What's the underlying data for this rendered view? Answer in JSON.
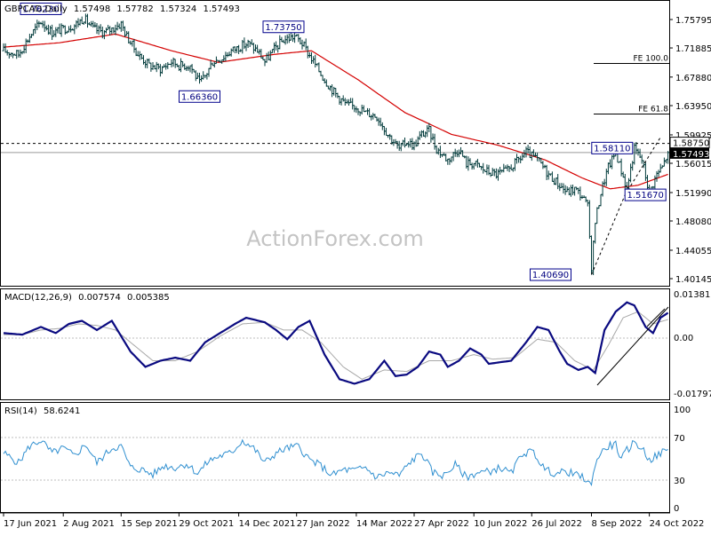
{
  "header": {
    "symbol": "GBPCAD,Daily",
    "ohlc": [
      "1.57498",
      "1.57782",
      "1.57324",
      "1.57493"
    ]
  },
  "watermark": "ActionForex.com",
  "colors": {
    "bar": "#003a3a",
    "ma": "#d40000",
    "macd": "#0a0a80",
    "signal": "#a8a8a8",
    "rsi": "#2f8fd0",
    "label_border": "#00008b",
    "label_text": "#000080",
    "grid": "#d9d9d9",
    "axis": "#000000"
  },
  "x_axis": {
    "labels": [
      "17 Jun 2021",
      "2 Aug 2021",
      "15 Sep 2021",
      "29 Oct 2021",
      "14 Dec 2021",
      "27 Jan 2022",
      "14 Mar 2022",
      "27 Apr 2022",
      "10 Jun 2022",
      "26 Jul 2022",
      "8 Sep 2022",
      "24 Oct 2022"
    ],
    "label_bar_index": [
      0,
      32,
      63,
      94,
      126,
      157,
      189,
      220,
      252,
      283,
      315,
      346
    ]
  },
  "price_axis": {
    "ticks": [
      "1.75795",
      "1.71885",
      "1.67880",
      "1.63950",
      "1.59925",
      "1.56015",
      "1.51990",
      "1.48080",
      "1.44055",
      "1.40145"
    ],
    "current_price": "1.57493",
    "level_price": "1.58750"
  },
  "macd_axis": {
    "title": "MACD(12,26,9)",
    "readout": [
      "0.007574",
      "0.005385"
    ],
    "ticks": [
      "0.013816",
      "0.00",
      "-0.017973"
    ]
  },
  "rsi_axis": {
    "title": "RSI(14)",
    "readout": "58.6241",
    "ticks": [
      "100",
      "70",
      "30",
      "0"
    ]
  },
  "annotations": {
    "highs_lows": [
      {
        "label": "1.76230",
        "price": 1.7623,
        "bar": 20,
        "side": "above"
      },
      {
        "label": "1.66360",
        "price": 1.6636,
        "bar": 105,
        "side": "below"
      },
      {
        "label": "1.73750",
        "price": 1.7375,
        "bar": 150,
        "side": "above"
      },
      {
        "label": "1.58110",
        "price": 1.5811,
        "bar": 338,
        "side": "left"
      },
      {
        "label": "1.51670",
        "price": 1.5167,
        "bar": 332,
        "side": "right"
      },
      {
        "label": "1.40690",
        "price": 1.4069,
        "bar": 305,
        "side": "left"
      }
    ],
    "fibo": [
      {
        "label": "FE 100.0",
        "price": 1.6975
      },
      {
        "label": "FE 61.8",
        "price": 1.628
      }
    ]
  },
  "chart_data": [
    {
      "type": "candlestick",
      "title": "GBPCAD,Daily",
      "timeframe": "Daily",
      "ylim": [
        1.40145,
        1.77
      ],
      "x_range": [
        "17 Jun 2021",
        "8 Nov 2022"
      ],
      "series": [
        {
          "name": "price",
          "key_points": [
            [
              0,
              1.715
            ],
            [
              8,
              1.71
            ],
            [
              14,
              1.735
            ],
            [
              20,
              1.755
            ],
            [
              26,
              1.74
            ],
            [
              32,
              1.745
            ],
            [
              38,
              1.75
            ],
            [
              43,
              1.76
            ],
            [
              48,
              1.745
            ],
            [
              54,
              1.74
            ],
            [
              58,
              1.745
            ],
            [
              63,
              1.752
            ],
            [
              66,
              1.735
            ],
            [
              72,
              1.71
            ],
            [
              78,
              1.695
            ],
            [
              84,
              1.69
            ],
            [
              90,
              1.7
            ],
            [
              94,
              1.695
            ],
            [
              100,
              1.695
            ],
            [
              105,
              1.67
            ],
            [
              108,
              1.68
            ],
            [
              112,
              1.7
            ],
            [
              117,
              1.705
            ],
            [
              122,
              1.715
            ],
            [
              126,
              1.72
            ],
            [
              131,
              1.725
            ],
            [
              136,
              1.715
            ],
            [
              140,
              1.7
            ],
            [
              146,
              1.72
            ],
            [
              150,
              1.73
            ],
            [
              156,
              1.735
            ],
            [
              160,
              1.725
            ],
            [
              166,
              1.7
            ],
            [
              172,
              1.675
            ],
            [
              178,
              1.655
            ],
            [
              184,
              1.64
            ],
            [
              189,
              1.638
            ],
            [
              194,
              1.63
            ],
            [
              200,
              1.625
            ],
            [
              206,
              1.6
            ],
            [
              212,
              1.58
            ],
            [
              216,
              1.59
            ],
            [
              220,
              1.585
            ],
            [
              224,
              1.6
            ],
            [
              228,
              1.605
            ],
            [
              232,
              1.58
            ],
            [
              238,
              1.565
            ],
            [
              244,
              1.58
            ],
            [
              248,
              1.56
            ],
            [
              252,
              1.56
            ],
            [
              258,
              1.55
            ],
            [
              264,
              1.545
            ],
            [
              270,
              1.55
            ],
            [
              276,
              1.565
            ],
            [
              280,
              1.575
            ],
            [
              286,
              1.565
            ],
            [
              292,
              1.545
            ],
            [
              298,
              1.53
            ],
            [
              302,
              1.52
            ],
            [
              306,
              1.525
            ],
            [
              310,
              1.515
            ],
            [
              313,
              1.5
            ],
            [
              315,
              1.418
            ],
            [
              317,
              1.48
            ],
            [
              320,
              1.52
            ],
            [
              324,
              1.555
            ],
            [
              328,
              1.575
            ],
            [
              331,
              1.55
            ],
            [
              334,
              1.525
            ],
            [
              338,
              1.58
            ],
            [
              342,
              1.565
            ],
            [
              346,
              1.52
            ],
            [
              350,
              1.545
            ],
            [
              353,
              1.555
            ],
            [
              356,
              1.5749
            ]
          ]
        },
        {
          "name": "MA",
          "key_points": [
            [
              0,
              1.72
            ],
            [
              30,
              1.726
            ],
            [
              60,
              1.738
            ],
            [
              90,
              1.715
            ],
            [
              115,
              1.699
            ],
            [
              145,
              1.71
            ],
            [
              165,
              1.715
            ],
            [
              190,
              1.675
            ],
            [
              215,
              1.63
            ],
            [
              240,
              1.6
            ],
            [
              265,
              1.585
            ],
            [
              290,
              1.565
            ],
            [
              310,
              1.54
            ],
            [
              325,
              1.525
            ],
            [
              340,
              1.53
            ],
            [
              356,
              1.545
            ]
          ]
        }
      ]
    },
    {
      "type": "line",
      "title": "MACD(12,26,9)",
      "ylim": [
        -0.017973,
        0.013816
      ],
      "series": [
        {
          "name": "MACD",
          "key_points": [
            [
              0,
              0.001
            ],
            [
              10,
              0.0005
            ],
            [
              20,
              0.003
            ],
            [
              28,
              0.001
            ],
            [
              35,
              0.004
            ],
            [
              42,
              0.005
            ],
            [
              50,
              0.002
            ],
            [
              58,
              0.005
            ],
            [
              68,
              -0.005
            ],
            [
              76,
              -0.01
            ],
            [
              84,
              -0.008
            ],
            [
              92,
              -0.007
            ],
            [
              100,
              -0.008
            ],
            [
              108,
              -0.002
            ],
            [
              116,
              0.001
            ],
            [
              124,
              0.004
            ],
            [
              130,
              0.006
            ],
            [
              140,
              0.0045
            ],
            [
              146,
              0.002
            ],
            [
              152,
              -0.001
            ],
            [
              158,
              0.003
            ],
            [
              164,
              0.005
            ],
            [
              172,
              -0.006
            ],
            [
              180,
              -0.014
            ],
            [
              188,
              -0.0155
            ],
            [
              196,
              -0.014
            ],
            [
              204,
              -0.008
            ],
            [
              210,
              -0.013
            ],
            [
              216,
              -0.0125
            ],
            [
              222,
              -0.01
            ],
            [
              228,
              -0.005
            ],
            [
              234,
              -0.006
            ],
            [
              238,
              -0.01
            ],
            [
              244,
              -0.008
            ],
            [
              250,
              -0.004
            ],
            [
              256,
              -0.006
            ],
            [
              260,
              -0.009
            ],
            [
              266,
              -0.0085
            ],
            [
              272,
              -0.008
            ],
            [
              280,
              -0.002
            ],
            [
              286,
              0.003
            ],
            [
              292,
              0.002
            ],
            [
              298,
              -0.005
            ],
            [
              302,
              -0.009
            ],
            [
              308,
              -0.011
            ],
            [
              313,
              -0.01
            ],
            [
              317,
              -0.012
            ],
            [
              322,
              0.002
            ],
            [
              328,
              0.008
            ],
            [
              334,
              0.011
            ],
            [
              338,
              0.01
            ],
            [
              344,
              0.003
            ],
            [
              348,
              0.001
            ],
            [
              352,
              0.006
            ],
            [
              356,
              0.0076
            ]
          ]
        },
        {
          "name": "Signal",
          "key_points": [
            [
              0,
              0.0005
            ],
            [
              10,
              0.0005
            ],
            [
              20,
              0.002
            ],
            [
              30,
              0.0025
            ],
            [
              40,
              0.004
            ],
            [
              50,
              0.0035
            ],
            [
              60,
              0.002
            ],
            [
              70,
              -0.003
            ],
            [
              80,
              -0.008
            ],
            [
              92,
              -0.008
            ],
            [
              104,
              -0.005
            ],
            [
              116,
              0.0
            ],
            [
              128,
              0.004
            ],
            [
              140,
              0.0045
            ],
            [
              150,
              0.002
            ],
            [
              160,
              0.002
            ],
            [
              170,
              -0.002
            ],
            [
              182,
              -0.01
            ],
            [
              192,
              -0.014
            ],
            [
              204,
              -0.011
            ],
            [
              216,
              -0.0115
            ],
            [
              228,
              -0.008
            ],
            [
              240,
              -0.008
            ],
            [
              252,
              -0.006
            ],
            [
              262,
              -0.0075
            ],
            [
              274,
              -0.007
            ],
            [
              286,
              -0.001
            ],
            [
              296,
              -0.002
            ],
            [
              306,
              -0.008
            ],
            [
              316,
              -0.011
            ],
            [
              324,
              -0.003
            ],
            [
              332,
              0.006
            ],
            [
              340,
              0.008
            ],
            [
              348,
              0.004
            ],
            [
              356,
              0.0054
            ]
          ]
        }
      ]
    },
    {
      "type": "line",
      "title": "RSI(14)",
      "ylim": [
        0,
        100
      ],
      "series": [
        {
          "name": "RSI",
          "key_points": [
            [
              0,
              55
            ],
            [
              8,
              45
            ],
            [
              14,
              62
            ],
            [
              20,
              68
            ],
            [
              26,
              55
            ],
            [
              32,
              60
            ],
            [
              38,
              52
            ],
            [
              44,
              64
            ],
            [
              50,
              45
            ],
            [
              58,
              60
            ],
            [
              63,
              62
            ],
            [
              68,
              40
            ],
            [
              74,
              38
            ],
            [
              80,
              33
            ],
            [
              86,
              42
            ],
            [
              92,
              40
            ],
            [
              98,
              44
            ],
            [
              104,
              34
            ],
            [
              110,
              47
            ],
            [
              116,
              52
            ],
            [
              122,
              55
            ],
            [
              128,
              68
            ],
            [
              134,
              60
            ],
            [
              140,
              45
            ],
            [
              146,
              55
            ],
            [
              152,
              60
            ],
            [
              158,
              62
            ],
            [
              164,
              48
            ],
            [
              170,
              42
            ],
            [
              176,
              32
            ],
            [
              182,
              38
            ],
            [
              188,
              37
            ],
            [
              194,
              40
            ],
            [
              200,
              30
            ],
            [
              206,
              35
            ],
            [
              212,
              32
            ],
            [
              218,
              46
            ],
            [
              224,
              55
            ],
            [
              230,
              35
            ],
            [
              236,
              32
            ],
            [
              242,
              43
            ],
            [
              248,
              30
            ],
            [
              254,
              35
            ],
            [
              260,
              36
            ],
            [
              266,
              40
            ],
            [
              272,
              34
            ],
            [
              278,
              55
            ],
            [
              284,
              56
            ],
            [
              290,
              38
            ],
            [
              296,
              34
            ],
            [
              302,
              36
            ],
            [
              306,
              33
            ],
            [
              310,
              30
            ],
            [
              313,
              27
            ],
            [
              315,
              20
            ],
            [
              317,
              45
            ],
            [
              320,
              55
            ],
            [
              324,
              62
            ],
            [
              328,
              64
            ],
            [
              331,
              48
            ],
            [
              334,
              58
            ],
            [
              338,
              66
            ],
            [
              342,
              60
            ],
            [
              346,
              48
            ],
            [
              350,
              52
            ],
            [
              353,
              56
            ],
            [
              356,
              58.62
            ]
          ]
        }
      ]
    }
  ]
}
